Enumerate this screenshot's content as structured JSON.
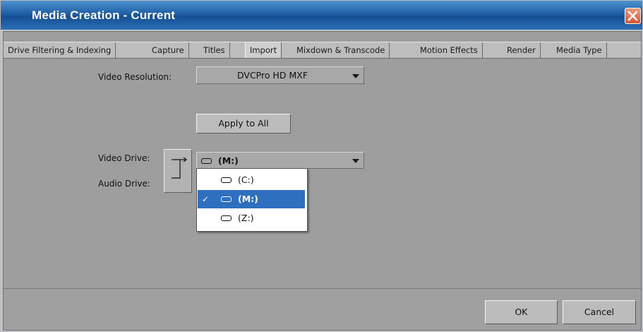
{
  "window": {
    "title": "Media Creation - Current"
  },
  "tabs": [
    {
      "label": "Drive Filtering & Indexing",
      "active": false
    },
    {
      "label": "Capture",
      "active": false
    },
    {
      "label": "Titles",
      "active": false
    },
    {
      "label": "Import",
      "active": true
    },
    {
      "label": "Mixdown & Transcode",
      "active": false
    },
    {
      "label": "Motion Effects",
      "active": false
    },
    {
      "label": "Render",
      "active": false
    },
    {
      "label": "Media Type",
      "active": false
    }
  ],
  "form": {
    "video_resolution_label": "Video Resolution:",
    "video_resolution_value": "DVCPro HD  MXF",
    "apply_all_label": "Apply to All",
    "video_drive_label": "Video Drive:",
    "audio_drive_label": "Audio Drive:",
    "video_drive_value": "(M:)"
  },
  "drive_menu": {
    "options": [
      {
        "label": "(C:)",
        "selected": false
      },
      {
        "label": "(M:)",
        "selected": true
      },
      {
        "label": "(Z:)",
        "selected": false
      }
    ],
    "check_glyph": "✓"
  },
  "footer": {
    "ok_label": "OK",
    "cancel_label": "Cancel"
  },
  "colors": {
    "title_bar": "#1f5fa6",
    "selection": "#2f6fbf",
    "close_button": "#d9532e"
  },
  "icons": {
    "close": "close-icon",
    "drive": "drive-icon",
    "swap": "swap-drives-icon",
    "caret": "chevron-down-icon",
    "check": "checkmark-icon"
  }
}
